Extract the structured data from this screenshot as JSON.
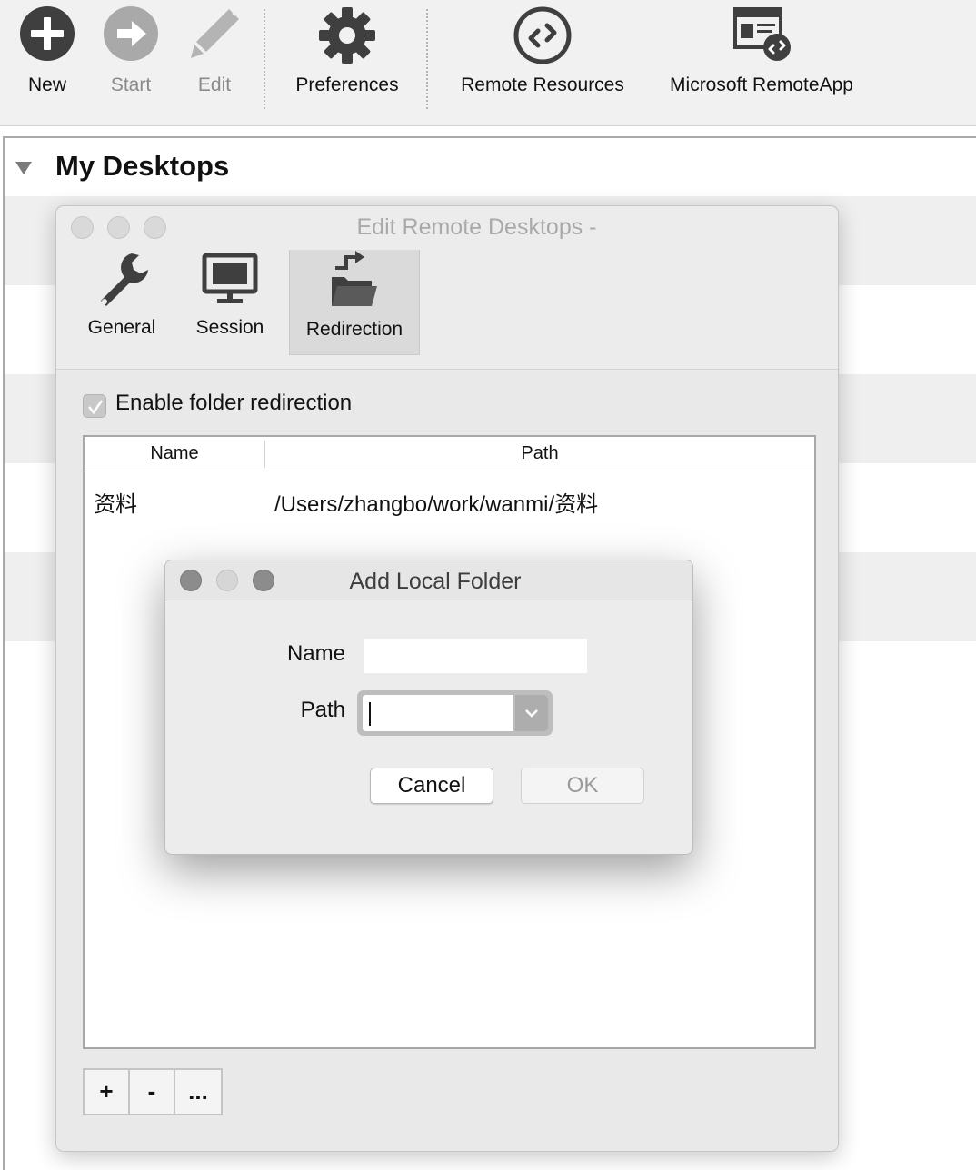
{
  "toolbar": {
    "new_label": "New",
    "start_label": "Start",
    "edit_label": "Edit",
    "preferences_label": "Preferences",
    "remote_resources_label": "Remote Resources",
    "remoteapp_label": "Microsoft RemoteApp"
  },
  "list": {
    "group_title": "My Desktops"
  },
  "edit_window": {
    "title": "Edit Remote Desktops -",
    "tabs": [
      {
        "label": "General",
        "icon": "wrench-icon"
      },
      {
        "label": "Session",
        "icon": "monitor-icon"
      },
      {
        "label": "Redirection",
        "icon": "folder-redirect-icon",
        "active": true
      }
    ],
    "enable_label": "Enable folder redirection",
    "enable_checked": true,
    "table": {
      "headers": [
        "Name",
        "Path"
      ],
      "rows": [
        {
          "name": "资料",
          "path": "/Users/zhangbo/work/wanmi/资料"
        }
      ]
    },
    "buttons": {
      "add": "+",
      "remove": "-",
      "more": "..."
    }
  },
  "add_dialog": {
    "title": "Add Local Folder",
    "name_label": "Name",
    "name_value": "",
    "path_label": "Path",
    "path_value": "",
    "cancel_label": "Cancel",
    "ok_label": "OK"
  },
  "colors": {
    "toolbar_bg": "#f1f1f1",
    "window_bg": "#ececec",
    "icon_dark": "#3f3f3f",
    "icon_disabled": "#a6a6a6"
  }
}
